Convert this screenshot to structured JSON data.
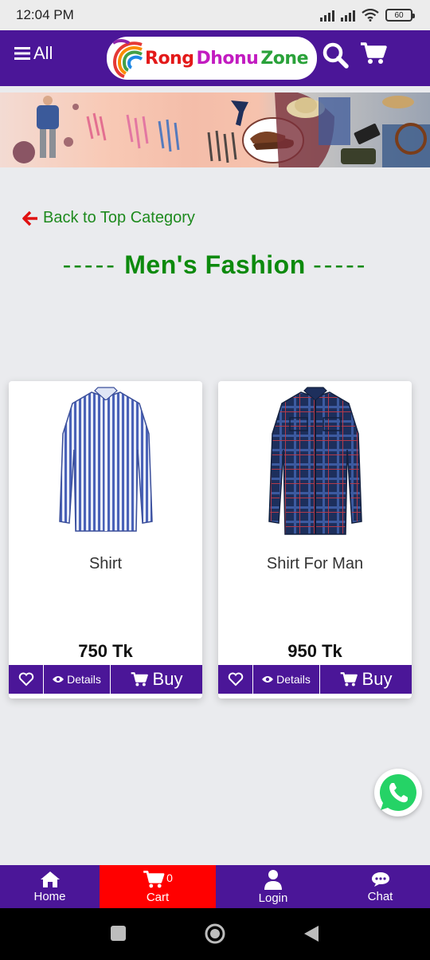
{
  "status_bar": {
    "time": "12:04 PM",
    "battery": "60"
  },
  "header": {
    "menu_label": "All",
    "logo_words": [
      "Rong",
      "Dhonu",
      "Zone"
    ]
  },
  "back_link": {
    "label": "Back to Top Category"
  },
  "category": {
    "dashes_left": "-----",
    "title": "Men's Fashion",
    "dashes_right": "-----"
  },
  "products": [
    {
      "name": "Shirt",
      "price": "750 Tk",
      "details_label": "Details",
      "buy_label": "Buy",
      "shirt_style": "striped"
    },
    {
      "name": "Shirt For Man",
      "price": "950 Tk",
      "details_label": "Details",
      "buy_label": "Buy",
      "shirt_style": "plaid"
    }
  ],
  "bottom_nav": {
    "home": "Home",
    "cart": "Cart",
    "cart_count": "0",
    "login": "Login",
    "chat": "Chat"
  },
  "colors": {
    "brand": "#4b1698",
    "accent_green": "#0d8a0d",
    "cart_red": "#ff0000"
  }
}
